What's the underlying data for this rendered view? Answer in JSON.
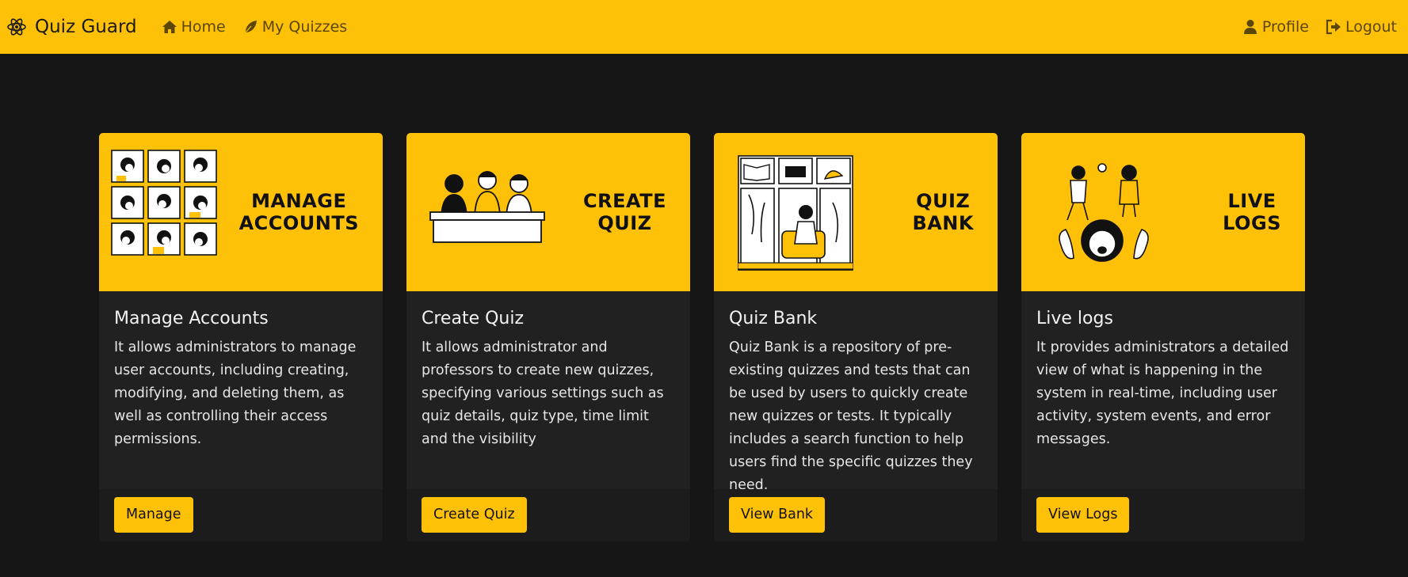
{
  "navbar": {
    "brand": "Quiz Guard",
    "links": [
      {
        "label": "Home",
        "icon": "home-icon"
      },
      {
        "label": "My Quizzes",
        "icon": "feather-icon"
      }
    ],
    "right_links": [
      {
        "label": "Profile",
        "icon": "user-icon"
      },
      {
        "label": "Logout",
        "icon": "logout-icon"
      }
    ]
  },
  "colors": {
    "accent": "#ffc107",
    "background": "#161616",
    "card": "#212121"
  },
  "cards": [
    {
      "banner": "MANAGE\nACCOUNTS",
      "title": "Manage Accounts",
      "text": "It allows administrators to manage user accounts, including creating, modifying, and deleting them, as well as controlling their access permissions.",
      "button": "Manage"
    },
    {
      "banner": "CREATE\nQUIZ",
      "title": "Create Quiz",
      "text": "It allows administrator and professors to create new quizzes, specifying various settings such as quiz details, quiz type, time limit and the visibility",
      "button": "Create Quiz"
    },
    {
      "banner": "QUIZ\nBANK",
      "title": "Quiz Bank",
      "text": "Quiz Bank is a repository of pre-existing quizzes and tests that can be used by users to quickly create new quizzes or tests. It typically includes a search function to help users find the specific quizzes they need.",
      "button": "View Bank"
    },
    {
      "banner": "LIVE\nLOGS",
      "title": "Live logs",
      "text": "It provides administrators a detailed view of what is happening in the system in real-time, including user activity, system events, and error messages.",
      "button": "View Logs"
    }
  ]
}
